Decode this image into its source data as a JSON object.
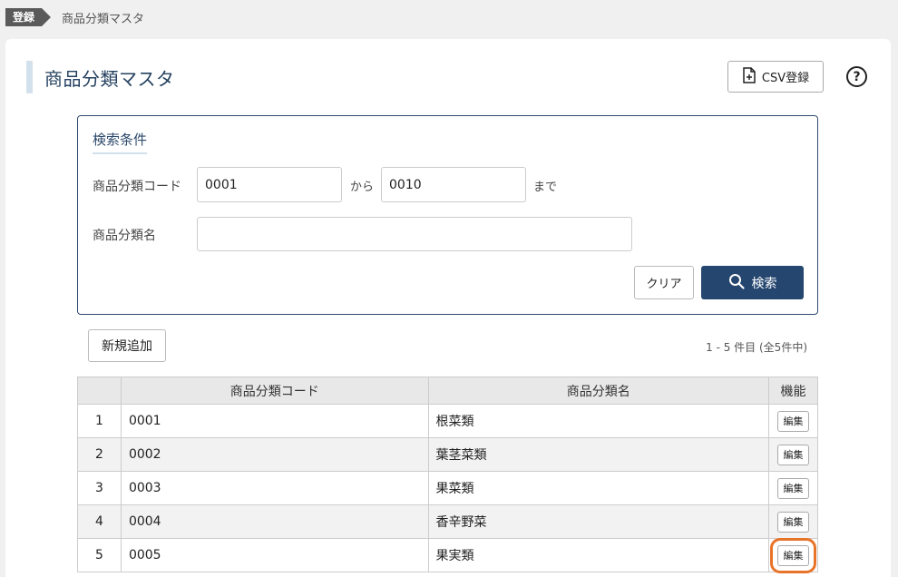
{
  "breadcrumb": {
    "tag": "登録",
    "current": "商品分類マスタ"
  },
  "page": {
    "title": "商品分類マスタ"
  },
  "toolbar": {
    "csv_label": "CSV登録",
    "help_symbol": "?"
  },
  "search": {
    "title": "検索条件",
    "code_label": "商品分類コード",
    "code_from": "0001",
    "from_text": "から",
    "code_to": "0010",
    "to_text": "まで",
    "name_label": "商品分類名",
    "name_value": "",
    "clear_label": "クリア",
    "search_label": "検索"
  },
  "list": {
    "new_label": "新規追加",
    "count_text": "1 - 5 件目 (全5件中)",
    "headers": {
      "no": "",
      "code": "商品分類コード",
      "name": "商品分類名",
      "func": "機能"
    },
    "edit_label": "編集",
    "rows": [
      {
        "no": "1",
        "code": "0001",
        "name": "根菜類"
      },
      {
        "no": "2",
        "code": "0002",
        "name": "葉茎菜類"
      },
      {
        "no": "3",
        "code": "0003",
        "name": "果菜類"
      },
      {
        "no": "4",
        "code": "0004",
        "name": "香辛野菜"
      },
      {
        "no": "5",
        "code": "0005",
        "name": "果実類"
      }
    ]
  },
  "colors": {
    "accent": "#24466f",
    "highlight": "#e8742a"
  }
}
